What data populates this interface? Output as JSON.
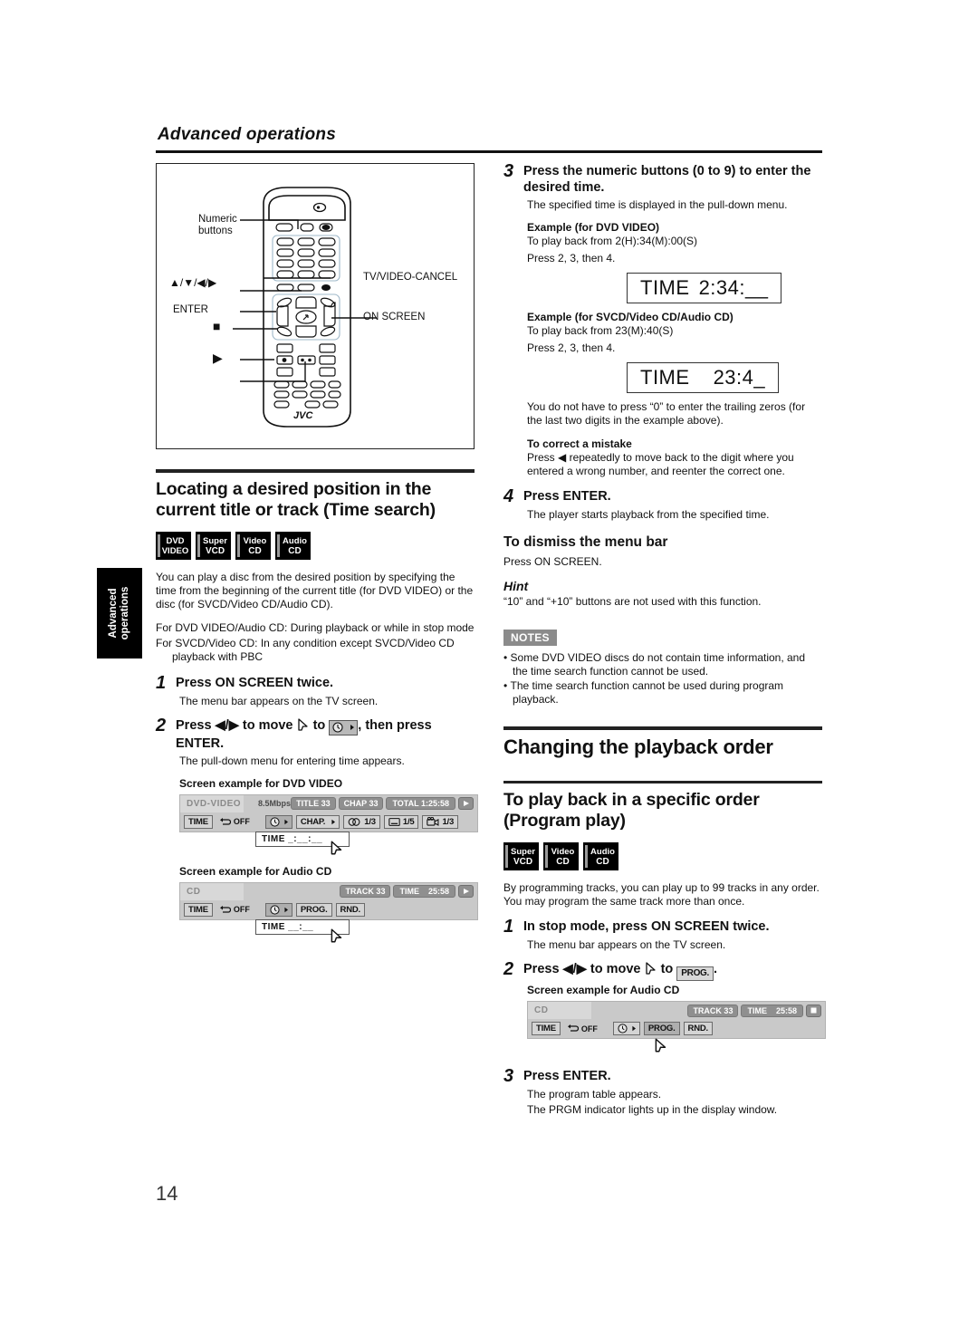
{
  "header": {
    "title": "Advanced operations"
  },
  "side_tab": {
    "line1": "Advanced",
    "line2": "operations"
  },
  "page_number": "14",
  "remote_figure": {
    "labels": {
      "numeric_buttons": "Numeric\nbuttons",
      "arrows": "▲/▼/◀/▶",
      "enter": "ENTER",
      "stop": "■",
      "play": "▶",
      "tv_video_cancel": "TV/VIDEO-CANCEL",
      "on_screen": "ON SCREEN"
    },
    "brand": "JVC"
  },
  "time_search": {
    "heading": "Locating a desired position in the current title or track (Time search)",
    "badges": [
      {
        "l1": "DVD",
        "l2": "VIDEO"
      },
      {
        "l1": "Super",
        "l2": "VCD"
      },
      {
        "l1": "Video",
        "l2": "CD"
      },
      {
        "l1": "Audio",
        "l2": "CD"
      }
    ],
    "intro": "You can play a disc from the desired position by specifying the time from the beginning of the current title (for DVD VIDEO) or the disc (for SVCD/Video CD/Audio CD).",
    "cond1": "For DVD VIDEO/Audio CD: During playback or while in stop mode",
    "cond2": "For SVCD/Video CD: In any condition except SVCD/Video CD playback with PBC",
    "step1_num": "1",
    "step1_title": "Press ON SCREEN twice.",
    "step1_body": "The menu bar appears on the TV screen.",
    "step2_num": "2",
    "step2_part1": "Press ◀/▶ to move",
    "step2_part2": "to",
    "step2_part3": ", then press",
    "step2_part4": "ENTER.",
    "step2_body": "The pull-down menu for entering time appears.",
    "example_dvd_caption": "Screen example for DVD VIDEO",
    "example_cd_caption": "Screen example for Audio CD"
  },
  "osd_dvd": {
    "disc": "DVD-VIDEO",
    "bitrate": "8.5Mbps",
    "title_pill": "TITLE 33",
    "chap_pill": "CHAP 33",
    "total_pill": "TOTAL 1:25:58",
    "buttons": {
      "time": "TIME",
      "repeat": "OFF",
      "chapter": "CHAP.",
      "audio": "1/3",
      "subtitle": "1/5",
      "angle": "1/3"
    },
    "pulldown": "TIME  _:__:__"
  },
  "osd_cd_left": {
    "disc": "CD",
    "track_pill": "TRACK 33",
    "time_pill_label": "TIME",
    "time_pill_value": "25:58",
    "buttons": {
      "time": "TIME",
      "repeat": "OFF",
      "prog": "PROG.",
      "rnd": "RND."
    },
    "pulldown": "TIME     __:__"
  },
  "osd_cd_right": {
    "disc": "CD",
    "track_pill": "TRACK 33",
    "time_pill_label": "TIME",
    "time_pill_value": "25:58",
    "buttons": {
      "time": "TIME",
      "repeat": "OFF",
      "prog": "PROG.",
      "rnd": "RND."
    }
  },
  "numeric_entry": {
    "step3_num": "3",
    "step3_title": "Press the numeric buttons (0 to 9) to enter the desired time.",
    "step3_body": "The specified time is displayed in the pull-down menu.",
    "example_dvd_label": "Example (for DVD VIDEO)",
    "example_dvd_line1": "To play back from 2(H):34(M):00(S)",
    "example_dvd_line2": "Press 2, 3, then 4.",
    "timebox_dvd_label": "TIME",
    "timebox_dvd_value": "2:34:__",
    "example_svcd_label": "Example (for SVCD/Video CD/Audio CD)",
    "example_svcd_line1": "To play back from 23(M):40(S)",
    "example_svcd_line2": "Press 2, 3, then 4.",
    "timebox_svcd_label": "TIME",
    "timebox_svcd_value": "23:4_",
    "trailing_zeros": "You do not have to press “0” to enter the trailing zeros (for the last two digits in the example above).",
    "correct_label": "To correct a mistake",
    "correct_body": "Press ◀ repeatedly to move back to the digit where you entered a wrong number, and reenter the correct one.",
    "step4_num": "4",
    "step4_title": "Press ENTER.",
    "step4_body": "The player starts playback from the specified time.",
    "dismiss_title": "To dismiss the menu bar",
    "dismiss_body": "Press ON SCREEN.",
    "hint_title": "Hint",
    "hint_body": "“10” and “+10” buttons are not used with this function.",
    "notes_label": "NOTES",
    "note1": "Some DVD VIDEO discs do not contain time information, and the time search function cannot be used.",
    "note2": "The time search function cannot be used during program playback."
  },
  "program_play": {
    "section_heading": "Changing the playback order",
    "sub_heading": "To play back in a specific order (Program play)",
    "badges": [
      {
        "l1": "Super",
        "l2": "VCD"
      },
      {
        "l1": "Video",
        "l2": "CD"
      },
      {
        "l1": "Audio",
        "l2": "CD"
      }
    ],
    "intro": "By programming tracks, you can play up to 99 tracks in any order. You may program the same track more than once.",
    "step1_num": "1",
    "step1_title": "In stop mode, press ON SCREEN twice.",
    "step1_body": "The menu bar appears on the TV screen.",
    "step2_num": "2",
    "step2_part1": "Press ◀/▶ to move",
    "step2_part2": "to",
    "step2_prog_label": "PROG.",
    "step2_part3": ".",
    "example_caption": "Screen example for Audio CD",
    "step3_num": "3",
    "step3_title": "Press ENTER.",
    "step3_body1": "The program table appears.",
    "step3_body2": "The PRGM indicator lights up in the display window."
  },
  "colors": {
    "ink": "#111111",
    "osd_bg": "#c9c9c9",
    "osd_pill": "#8f8f8f",
    "notes_badge": "#8b8b8b"
  }
}
